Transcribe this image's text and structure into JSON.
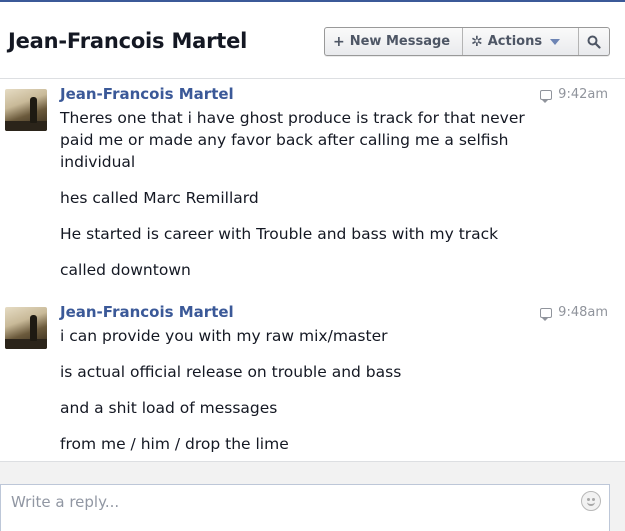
{
  "header": {
    "title": "Jean-Francois Martel",
    "new_message": {
      "icon": "plus-icon",
      "glyph": "+",
      "label": "New Message"
    },
    "actions": {
      "icon": "gear-icon",
      "glyph": "✲",
      "label": "Actions"
    },
    "search": {
      "icon": "search-icon"
    }
  },
  "messages": [
    {
      "sender": "Jean-Francois Martel",
      "time": "9:42am",
      "lines": [
        "Theres one that i have ghost produce is track for that never paid me or made any favor back after calling me a selfish individual",
        "hes called Marc Remillard",
        "He started is career with Trouble and bass with my track",
        "called downtown"
      ]
    },
    {
      "sender": "Jean-Francois Martel",
      "time": "9:48am",
      "lines": [
        "i can provide you with my raw mix/master",
        "is actual official release on trouble and bass",
        "and a shit load of messages",
        "from me / him / drop the lime"
      ]
    }
  ],
  "reply": {
    "placeholder": "Write a reply...",
    "emoji_icon": "smiley-icon"
  },
  "colors": {
    "link": "#3b5998",
    "timestamp": "#90949c",
    "text": "#141823"
  }
}
